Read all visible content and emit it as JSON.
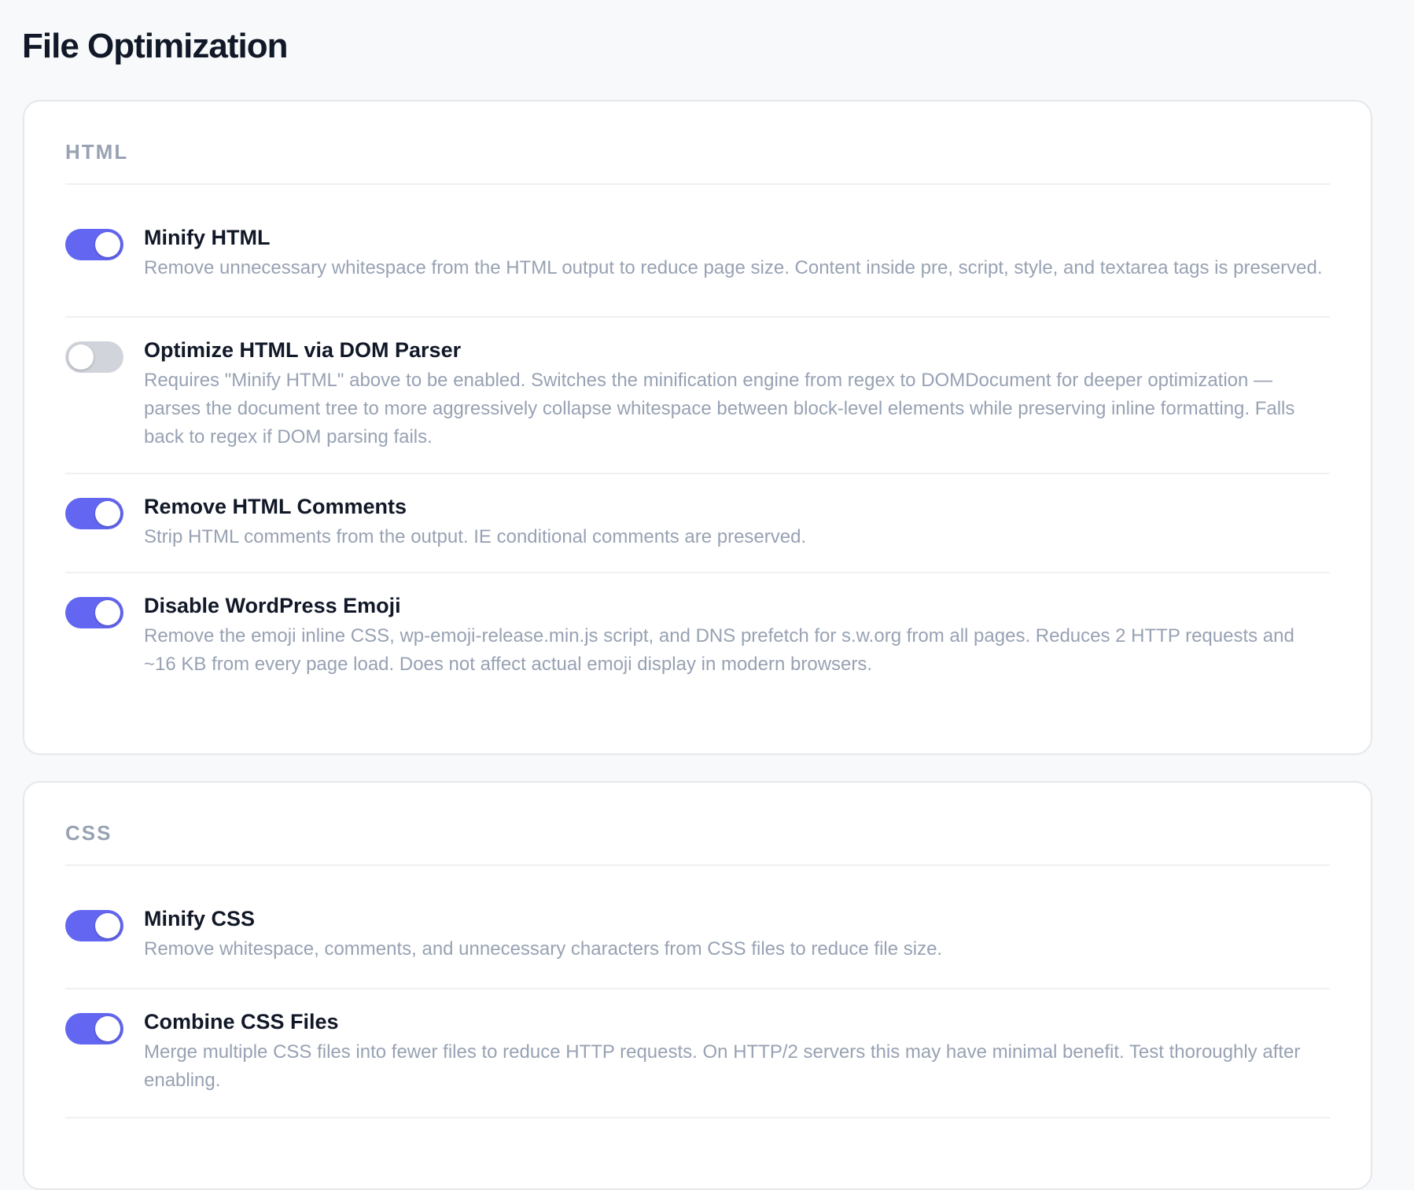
{
  "page": {
    "title": "File Optimization"
  },
  "colors": {
    "accent": "#6366f1",
    "toggle_off": "#d1d5db",
    "muted_text": "#98a2b3"
  },
  "sections": [
    {
      "title": "HTML",
      "settings": [
        {
          "label": "Minify HTML",
          "description": "Remove unnecessary whitespace from the HTML output to reduce page size. Content inside pre, script, style, and textarea tags is preserved.",
          "enabled": true
        },
        {
          "label": "Optimize HTML via DOM Parser",
          "description": "Requires \"Minify HTML\" above to be enabled. Switches the minification engine from regex to DOMDocument for deeper optimization — parses the document tree to more aggressively collapse whitespace between block-level elements while preserving inline formatting. Falls back to regex if DOM parsing fails.",
          "enabled": false
        },
        {
          "label": "Remove HTML Comments",
          "description": "Strip HTML comments from the output. IE conditional comments are preserved.",
          "enabled": true
        },
        {
          "label": "Disable WordPress Emoji",
          "description": "Remove the emoji inline CSS, wp-emoji-release.min.js script, and DNS prefetch for s.w.org from all pages. Reduces 2 HTTP requests and ~16 KB from every page load. Does not affect actual emoji display in modern browsers.",
          "enabled": true
        }
      ]
    },
    {
      "title": "CSS",
      "settings": [
        {
          "label": "Minify CSS",
          "description": "Remove whitespace, comments, and unnecessary characters from CSS files to reduce file size.",
          "enabled": true
        },
        {
          "label": "Combine CSS Files",
          "description": "Merge multiple CSS files into fewer files to reduce HTTP requests. On HTTP/2 servers this may have minimal benefit. Test thoroughly after enabling.",
          "enabled": true
        }
      ]
    }
  ]
}
